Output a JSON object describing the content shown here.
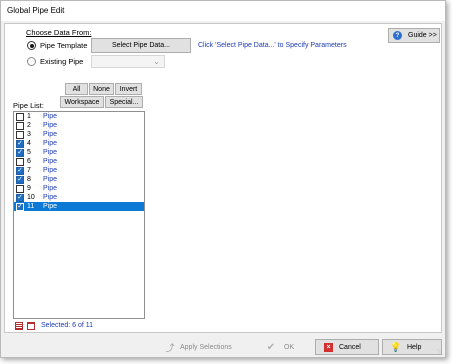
{
  "window": {
    "title": "Global Pipe Edit"
  },
  "choose": {
    "heading": "Choose Data From:",
    "pipe_template": {
      "label": "Pipe Template",
      "checked": true
    },
    "existing_pipe": {
      "label": "Existing Pipe",
      "checked": false
    },
    "select_button": "Select Pipe Data...",
    "hint": "Click 'Select Pipe Data...' to Specify Parameters",
    "existing_dropdown_value": ""
  },
  "guide_button": "Guide >>",
  "filters": {
    "all": "All",
    "none": "None",
    "invert": "Invert",
    "workspace": "Workspace",
    "special": "Special..."
  },
  "pipe_list": {
    "label": "Pipe List:",
    "items": [
      {
        "num": "1",
        "name": "Pipe",
        "checked": false,
        "selected": false
      },
      {
        "num": "2",
        "name": "Pipe",
        "checked": false,
        "selected": false
      },
      {
        "num": "3",
        "name": "Pipe",
        "checked": false,
        "selected": false
      },
      {
        "num": "4",
        "name": "Pipe",
        "checked": true,
        "selected": false
      },
      {
        "num": "5",
        "name": "Pipe",
        "checked": true,
        "selected": false
      },
      {
        "num": "6",
        "name": "Pipe",
        "checked": false,
        "selected": false
      },
      {
        "num": "7",
        "name": "Pipe",
        "checked": true,
        "selected": false
      },
      {
        "num": "8",
        "name": "Pipe",
        "checked": true,
        "selected": false
      },
      {
        "num": "9",
        "name": "Pipe",
        "checked": false,
        "selected": false
      },
      {
        "num": "10",
        "name": "Pipe",
        "checked": true,
        "selected": false
      },
      {
        "num": "11",
        "name": "Pipe",
        "checked": true,
        "selected": true
      }
    ]
  },
  "status": {
    "selected_text": "Selected: 6 of 11"
  },
  "actions": {
    "apply": "Apply Selections",
    "ok": "OK",
    "cancel": "Cancel",
    "help": "Help"
  },
  "colors": {
    "link_blue": "#1d3bb5",
    "selection": "#0c7ad4",
    "checkbox_on": "#1e6fc4",
    "cancel_red": "#d32f2f"
  }
}
